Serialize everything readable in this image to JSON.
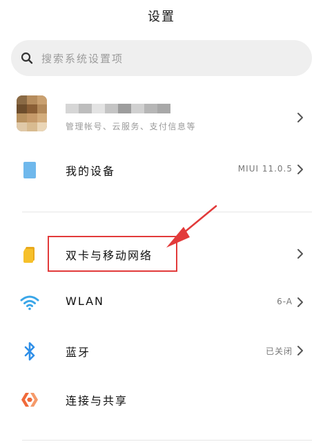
{
  "header": {
    "title": "设置"
  },
  "search": {
    "placeholder": "搜索系统设置项",
    "icon": "search-icon"
  },
  "account": {
    "name": "",
    "subtitle": "管理帐号、云服务、支付信息等"
  },
  "rows": [
    {
      "id": "my-device",
      "label": "我的设备",
      "value": "MIUI 11.0.5",
      "icon": "phone-icon",
      "icon_color": "#6fb8ec"
    },
    {
      "id": "dual-sim",
      "label": "双卡与移动网络",
      "value": "",
      "icon": "sim-card-icon",
      "icon_color": "#f6c02a"
    },
    {
      "id": "wlan",
      "label": "WLAN",
      "value": "6-A",
      "icon": "wifi-icon",
      "icon_color": "#3aa6e8"
    },
    {
      "id": "bluetooth",
      "label": "蓝牙",
      "value": "已关闭",
      "icon": "bluetooth-icon",
      "icon_color": "#2f8fe8"
    },
    {
      "id": "connect-share",
      "label": "连接与共享",
      "value": "",
      "icon": "connect-share-icon",
      "icon_color": "#f06a3a"
    }
  ],
  "annotation": {
    "color": "#e23a3a"
  }
}
